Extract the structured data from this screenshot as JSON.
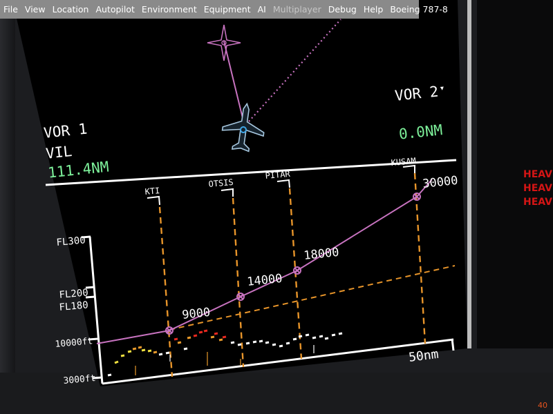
{
  "menu": {
    "items": [
      {
        "label": "File",
        "enabled": true
      },
      {
        "label": "View",
        "enabled": true
      },
      {
        "label": "Location",
        "enabled": true
      },
      {
        "label": "Autopilot",
        "enabled": true
      },
      {
        "label": "Environment",
        "enabled": true
      },
      {
        "label": "Equipment",
        "enabled": true
      },
      {
        "label": "AI",
        "enabled": true
      },
      {
        "label": "Multiplayer",
        "enabled": false
      },
      {
        "label": "Debug",
        "enabled": true
      },
      {
        "label": "Help",
        "enabled": true
      },
      {
        "label": "Boeing 787-8",
        "enabled": true
      }
    ]
  },
  "nd": {
    "vor1": {
      "label": "VOR 1",
      "ident": "VIL",
      "distance": "111.4NM"
    },
    "vor2": {
      "label": "VOR 2",
      "distance": "0.0NM"
    },
    "waypoints": [
      "KTI",
      "OTSIS",
      "PITAR",
      "KUSAM"
    ],
    "altitudes": [
      "9000",
      "14000",
      "18000",
      "30000"
    ],
    "vsd_axis": [
      "FL300",
      "FL200",
      "FL180",
      "10000ft",
      "3000ft"
    ],
    "range_label": "50nm"
  },
  "caution": {
    "lines": [
      "HEAV",
      "HEAV",
      "HEAV"
    ]
  },
  "frame_counter": "40",
  "colors": {
    "route": "#c873c0",
    "waypoint_line": "#e8952a",
    "terrain_red": "#e8291f",
    "terrain_amber": "#e89a2a",
    "terrain_yellow": "#f0e040",
    "vor_green": "#7df09a",
    "caution_red": "#d41515"
  }
}
